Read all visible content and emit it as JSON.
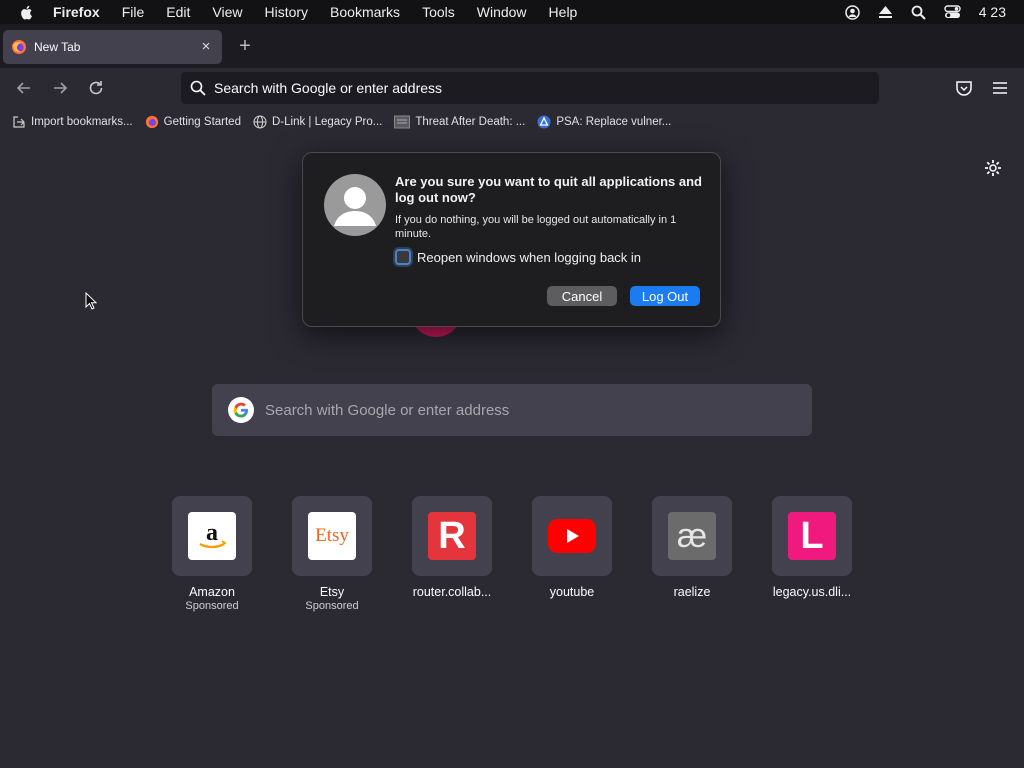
{
  "menubar": {
    "app_name": "Firefox",
    "menus": [
      "File",
      "Edit",
      "View",
      "History",
      "Bookmarks",
      "Tools",
      "Window",
      "Help"
    ],
    "clock": "4 23"
  },
  "tab": {
    "title": "New Tab",
    "close": "×",
    "new_tab": "+"
  },
  "urlbar": {
    "placeholder": "Search with Google or enter address"
  },
  "bookmarks": [
    {
      "label": "Import bookmarks...",
      "icon": "import-icon"
    },
    {
      "label": "Getting Started",
      "icon": "firefox-icon"
    },
    {
      "label": "D-Link | Legacy Pro...",
      "icon": "globe-icon"
    },
    {
      "label": "Threat After Death: ...",
      "icon": "page-icon"
    },
    {
      "label": "PSA: Replace vulner...",
      "icon": "triangle-icon"
    }
  ],
  "search": {
    "placeholder": "Search with Google or enter address"
  },
  "tiles": [
    {
      "label": "Amazon",
      "sub": "Sponsored",
      "icon": "amazon-icon"
    },
    {
      "label": "Etsy",
      "sub": "Sponsored",
      "icon": "etsy-icon",
      "icon_text": "Etsy"
    },
    {
      "label": "router.collab...",
      "sub": "",
      "icon": "router-icon",
      "icon_text": "R"
    },
    {
      "label": "youtube",
      "sub": "",
      "icon": "youtube-icon"
    },
    {
      "label": "raelize",
      "sub": "",
      "icon": "raelize-icon",
      "icon_text": "æ"
    },
    {
      "label": "legacy.us.dli...",
      "sub": "",
      "icon": "legacy-icon",
      "icon_text": "L"
    }
  ],
  "dialog": {
    "question": "Are you sure you want to quit all applications and log out now?",
    "info": "If you do nothing, you will be logged out automatically in 1 minute.",
    "checkbox_label": "Reopen windows when logging back in",
    "checkbox_checked": false,
    "cancel_label": "Cancel",
    "logout_label": "Log Out"
  },
  "colors": {
    "accent": "#1a7cf0",
    "background": "#2b2a33",
    "youtube": "#ff0000",
    "legacy": "#f0197d",
    "router": "#e4353d"
  }
}
